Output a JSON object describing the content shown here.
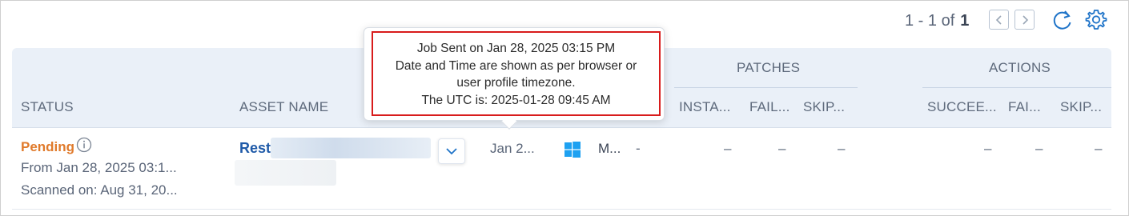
{
  "pagination": {
    "range": "1 - 1 of",
    "total": "1"
  },
  "toolbar_icons": [
    "chevron-left-icon",
    "chevron-right-icon",
    "refresh-icon",
    "gear-icon"
  ],
  "columns": {
    "status": "STATUS",
    "asset_name": "ASSET NAME",
    "patches_group": "PATCHES",
    "patches": [
      "INSTA...",
      "FAIL...",
      "SKIP..."
    ],
    "actions_group": "ACTIONS",
    "actions": [
      "SUCCEE...",
      "FAI...",
      "SKIP..."
    ]
  },
  "row": {
    "status": "Pending",
    "status_from": "From Jan 28, 2025 03:1...",
    "scanned_on": "Scanned on: Aug 31, 20...",
    "asset_name": "Rest",
    "date": "Jan 2...",
    "os_label": "M...",
    "os_dash": "-",
    "patches": [
      "–",
      "–",
      "–"
    ],
    "actions": [
      "–",
      "–",
      "–"
    ]
  },
  "tooltip": {
    "line1": "Job Sent on Jan 28, 2025 03:15 PM",
    "line2": "Date and Time are shown as per browser or",
    "line3": "user profile timezone.",
    "line4": "The UTC is: 2025-01-28 09:45 AM"
  },
  "colors": {
    "header_bg": "#eaf0f8",
    "pending": "#e07a2b",
    "link": "#1f5aa8",
    "accent_icon": "#1e73c8",
    "highlight_border": "#d81c1c",
    "windows_logo": "#1ea1f1"
  }
}
